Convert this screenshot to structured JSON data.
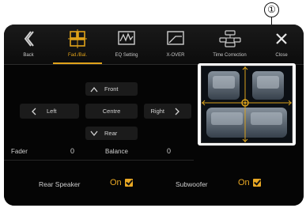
{
  "callout": {
    "number": "①"
  },
  "tabs": [
    {
      "label": "Back",
      "icon": "back-chevron-icon"
    },
    {
      "label": "Fad./Bal.",
      "icon": "fader-balance-icon",
      "active": true
    },
    {
      "label": "EQ Setting",
      "icon": "eq-icon"
    },
    {
      "label": "X-OVER",
      "icon": "crossover-icon"
    },
    {
      "label": "Time Correction",
      "icon": "time-correction-icon"
    },
    {
      "label": "Close",
      "icon": "close-icon"
    }
  ],
  "controls": {
    "front": "Front",
    "left": "Left",
    "centre": "Centre",
    "right": "Right",
    "rear": "Rear"
  },
  "fader": {
    "label": "Fader",
    "value": "0"
  },
  "balance": {
    "label": "Balance",
    "value": "0"
  },
  "rear_speaker": {
    "label": "Rear Speaker",
    "value": "On"
  },
  "subwoofer": {
    "label": "Subwoofer",
    "value": "On"
  },
  "colors": {
    "accent": "#e0a21a",
    "background": "#000000",
    "crosshair": "#d9a11c"
  }
}
